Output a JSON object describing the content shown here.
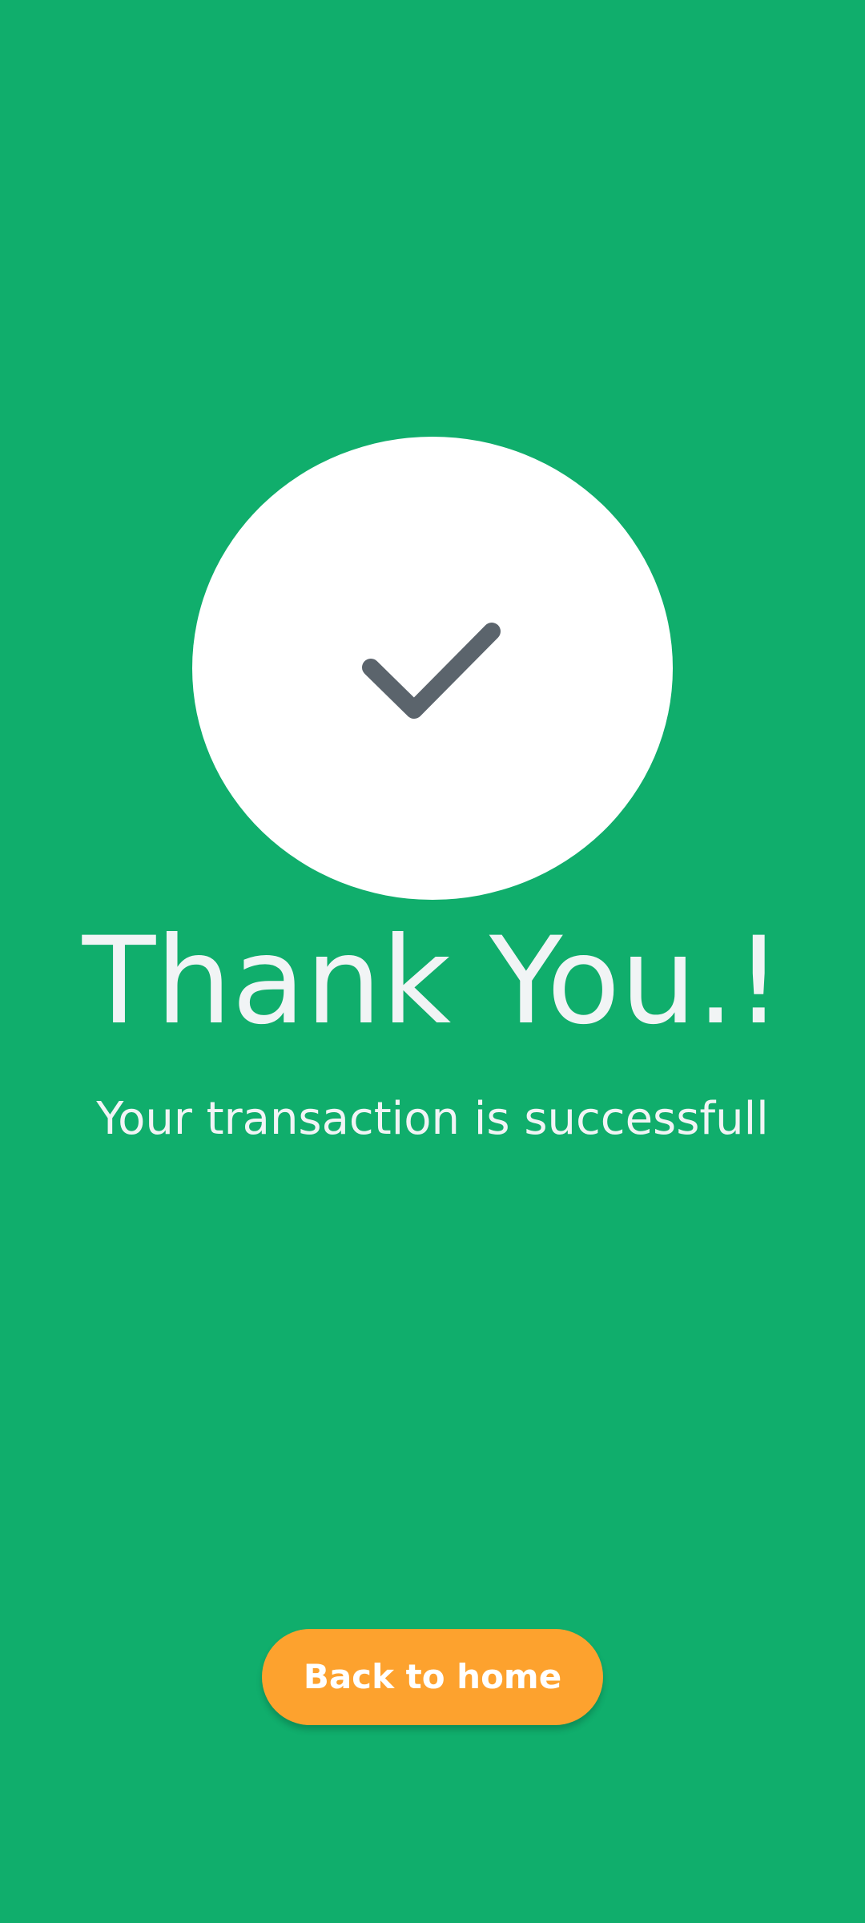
{
  "title": "Thank You.!",
  "subtitle": "Your transaction is successfull",
  "button": {
    "label": "Back to home"
  },
  "icons": {
    "success": "check-icon"
  },
  "colors": {
    "background": "#10AE6C",
    "circle": "#FFFFFF",
    "check": "#5B646C",
    "text": "#F1F4F5",
    "button": "#FDA22E",
    "button_text": "#FFFFFF"
  }
}
